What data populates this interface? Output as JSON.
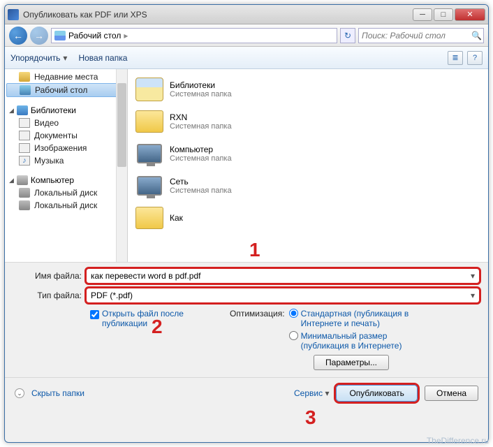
{
  "title": "Опубликовать как PDF или XPS",
  "winbtns": {
    "min": "─",
    "max": "□",
    "close": "✕"
  },
  "nav": {
    "back": "←",
    "fwd": "→",
    "refresh": "↻"
  },
  "address": {
    "location": "Рабочий стол",
    "sep": "▸"
  },
  "search": {
    "placeholder": "Поиск: Рабочий стол",
    "icon": "🔍"
  },
  "toolbar": {
    "organize": "Упорядочить",
    "newfolder": "Новая папка",
    "view_icon": "≣",
    "help_icon": "?"
  },
  "sidebar": {
    "recent": "Недавние места",
    "desktop": "Рабочий стол",
    "group_lib": "Библиотеки",
    "video": "Видео",
    "docs": "Документы",
    "images": "Изображения",
    "music": "Музыка",
    "group_comp": "Компьютер",
    "disk1": "Локальный диск",
    "disk2": "Локальный диск"
  },
  "files": {
    "lib": {
      "name": "Библиотеки",
      "type": "Системная папка"
    },
    "rxn": {
      "name": "RXN",
      "type": "Системная папка"
    },
    "comp": {
      "name": "Компьютер",
      "type": "Системная папка"
    },
    "net": {
      "name": "Сеть",
      "type": "Системная папка"
    },
    "kak": {
      "name": "Как",
      "type": ""
    }
  },
  "fields": {
    "filename_label": "Имя файла:",
    "filename_value": "как перевести word в pdf.pdf",
    "filetype_label": "Тип файла:",
    "filetype_value": "PDF (*.pdf)"
  },
  "options": {
    "open_after": "Открыть файл после публикации",
    "optimization": "Оптимизация:",
    "standard": "Стандартная (публикация в Интернете и печать)",
    "minimal": "Минимальный размер (публикация в Интернете)",
    "params": "Параметры..."
  },
  "footer": {
    "hide": "Скрыть папки",
    "tools": "Сервис",
    "publish": "Опубликовать",
    "cancel": "Отмена"
  },
  "annotations": {
    "n1": "1",
    "n2": "2",
    "n3": "3"
  },
  "watermark": "TheDifference.ru"
}
